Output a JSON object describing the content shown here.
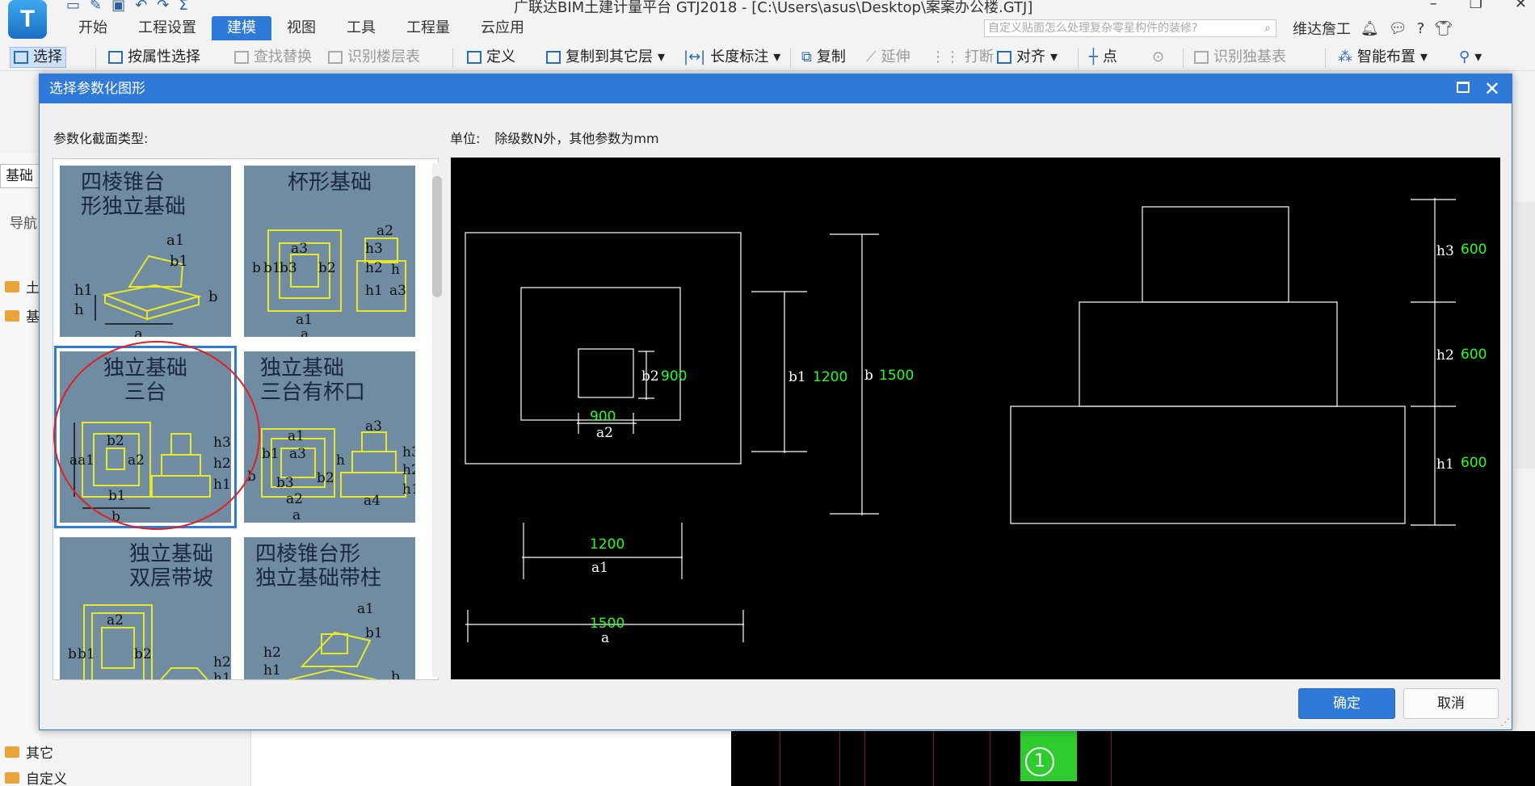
{
  "app": {
    "logo_letter": "T",
    "title": "广联达BIM土建计量平台 GTJ2018 - [C:\\Users\\asus\\Desktop\\案案办公楼.GTJ]"
  },
  "menu": {
    "tabs": [
      "开始",
      "工程设置",
      "建模",
      "视图",
      "工具",
      "工程量",
      "云应用"
    ],
    "active_tab": "建模",
    "search_placeholder": "自定义贴面怎么处理复杂零星构件的装修?",
    "user_name": "维达詹工"
  },
  "toolbar": {
    "select": "选择",
    "select_by_attr": "按属性选择",
    "find_replace": "查找替换",
    "identify_floor_table": "识别楼层表",
    "define": "定义",
    "copy_to_other_floor": "复制到其它层",
    "length_mark": "长度标注",
    "copy": "复制",
    "extend": "延伸",
    "break": "打断",
    "align": "对齐",
    "point": "点",
    "identify_foundation_table": "识别独基表",
    "smart_layout": "智能布置"
  },
  "background": {
    "left_tab": "基础",
    "nav_label": "导航",
    "tree_items": [
      "土",
      "基",
      "其它",
      "自定义"
    ],
    "grid_circle": "1"
  },
  "dialog": {
    "title": "选择参数化图形",
    "section_type_label": "参数化截面类型:",
    "unit_label": "单位:",
    "unit_text": "除级数N外，其他参数为mm",
    "thumbnails": [
      {
        "title": "四棱锥台\n形独立基础",
        "selected": false
      },
      {
        "title": "杯形基础",
        "selected": false
      },
      {
        "title": "独立基础\n三台",
        "selected": true
      },
      {
        "title": "独立基础\n三台有杯口",
        "selected": false
      },
      {
        "title": "独立基础\n双层带坡",
        "selected": false
      },
      {
        "title": "四棱锥台形\n独立基础带柱",
        "selected": false
      }
    ],
    "preview": {
      "a": "1500",
      "a1": "1200",
      "a2": "900",
      "b": "1500",
      "b1": "1200",
      "b2": "900",
      "h1": "600",
      "h2": "600",
      "h3": "600",
      "label_a": "a",
      "label_a1": "a1",
      "label_a2": "a2",
      "label_b": "b",
      "label_b1": "b1",
      "label_b2": "b2",
      "label_h1": "h1",
      "label_h2": "h2",
      "label_h3": "h3"
    },
    "ok_button": "确定",
    "cancel_button": "取消"
  },
  "colors": {
    "accent": "#2f7ad9",
    "dimension_value": "#22ff22",
    "thumb_bg": "#6f8ca3",
    "thumb_lines": "#e8e82a",
    "highlight_circle": "#e02020"
  }
}
